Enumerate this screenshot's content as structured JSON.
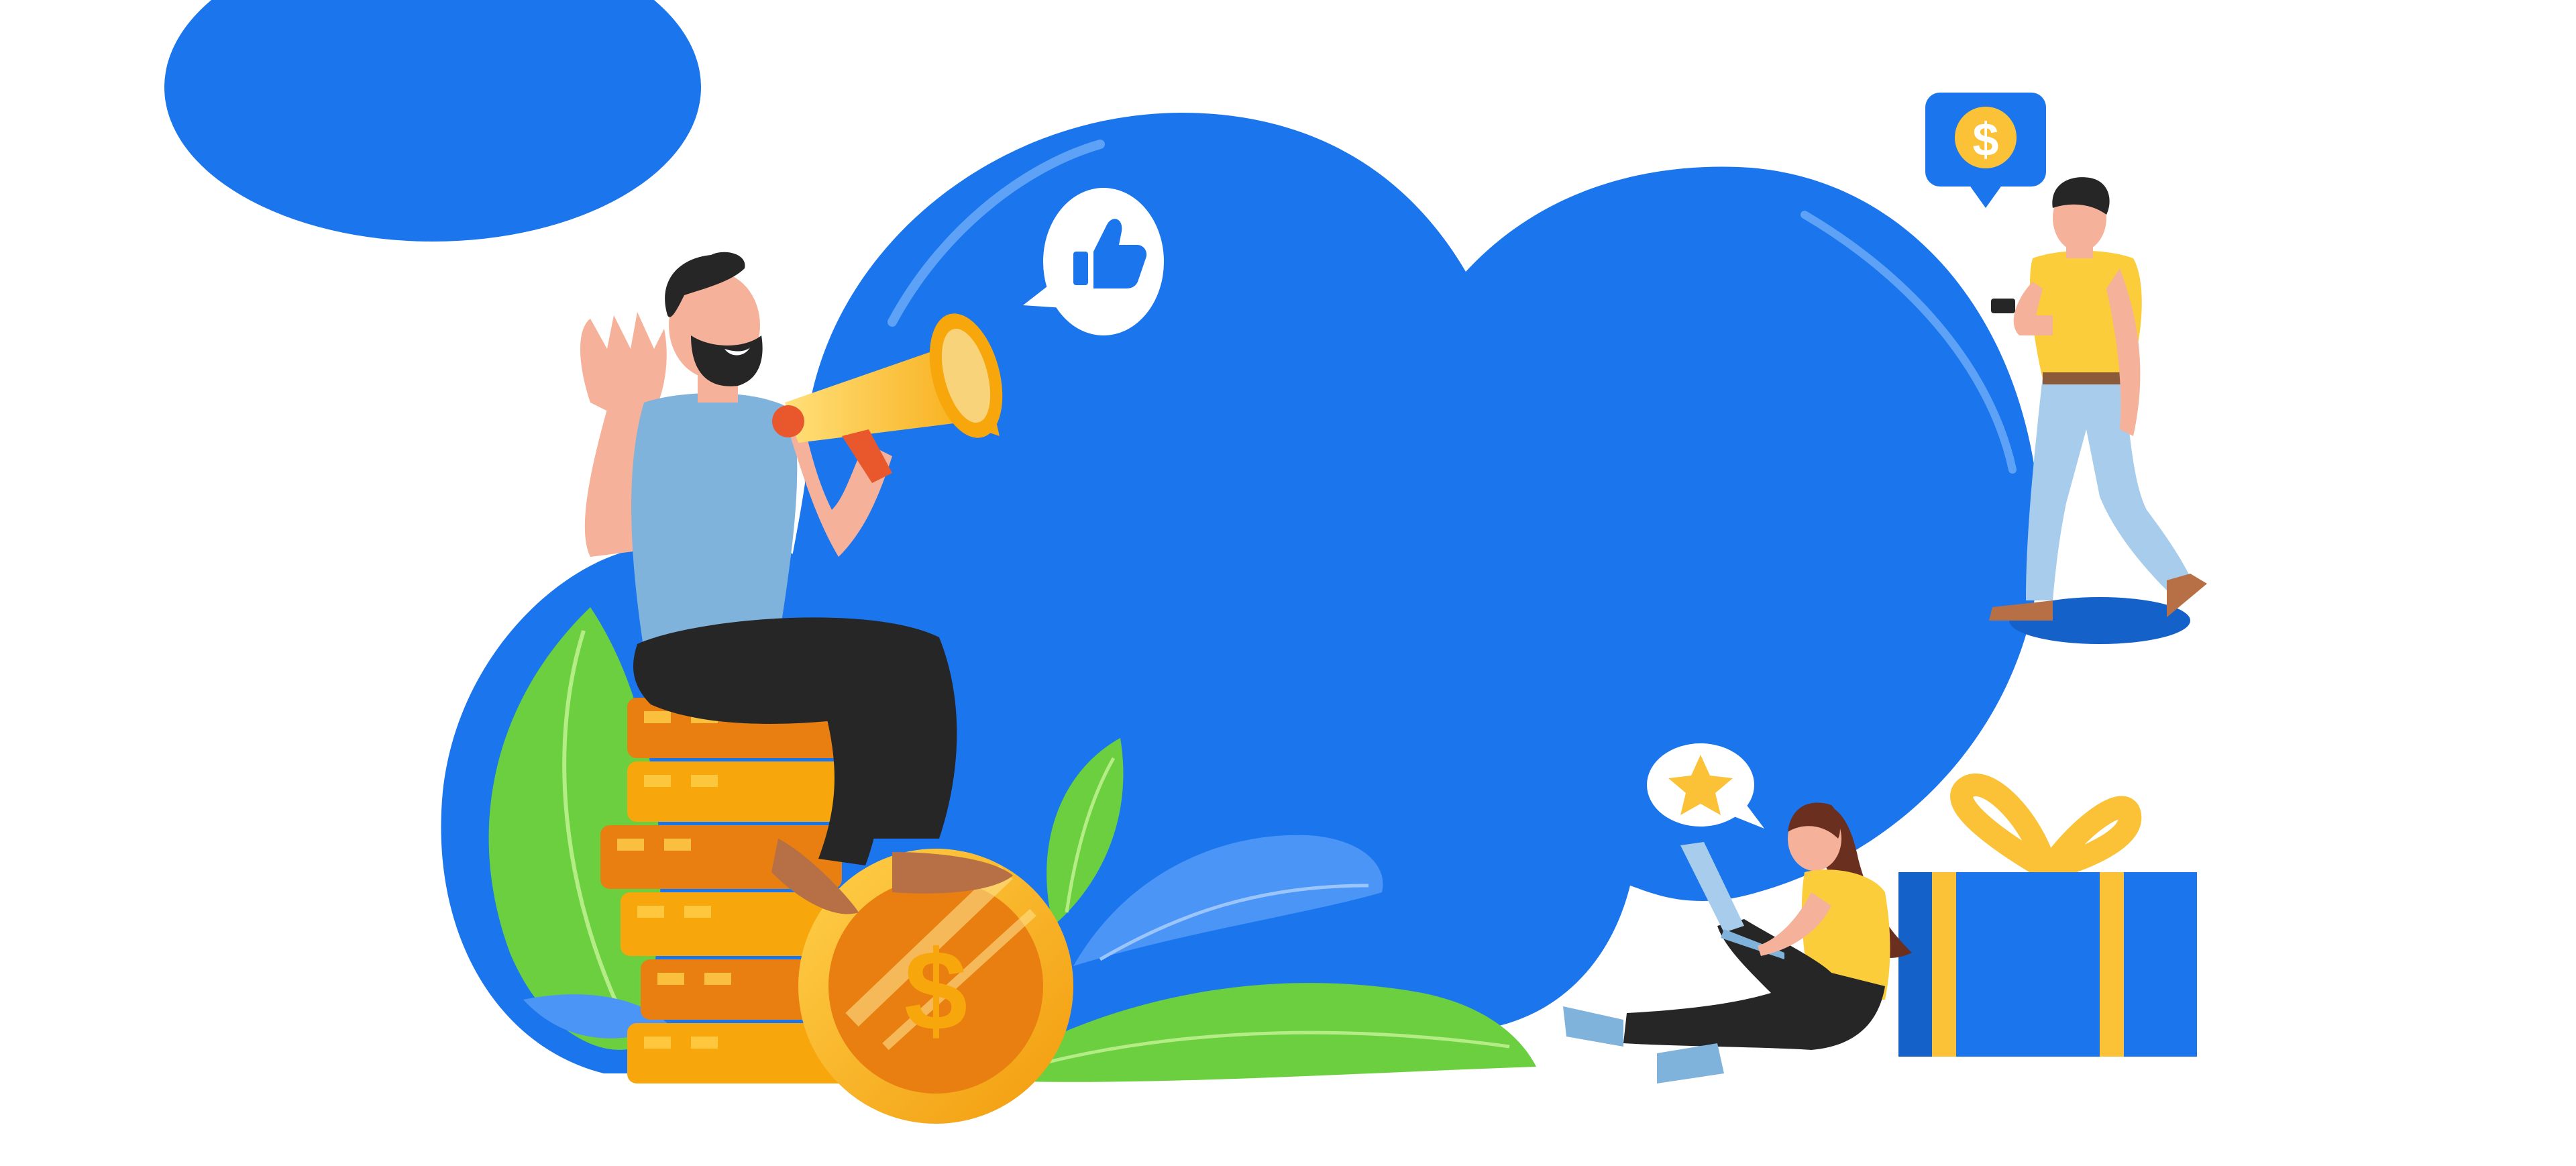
{
  "illustration": {
    "theme": "referral marketing",
    "currency_symbol": "$",
    "colors": {
      "background": "#ffffff",
      "blob_blue": "#1b76ee",
      "blob_blue_light": "#4a95f6",
      "coin_gold": "#f7a70c",
      "coin_orange": "#e97f10",
      "leaf_green": "#6bcf3f",
      "shirt_blue": "#80b3db",
      "shirt_yellow": "#fbcd3b",
      "pants_dark": "#262626",
      "skin": "#f6b19a",
      "gift_blue": "#1b76ee",
      "ribbon_gold": "#fbc237"
    },
    "icons": [
      "thumbs-up-icon",
      "dollar-icon",
      "star-icon",
      "megaphone-icon",
      "gift-box-icon"
    ]
  }
}
